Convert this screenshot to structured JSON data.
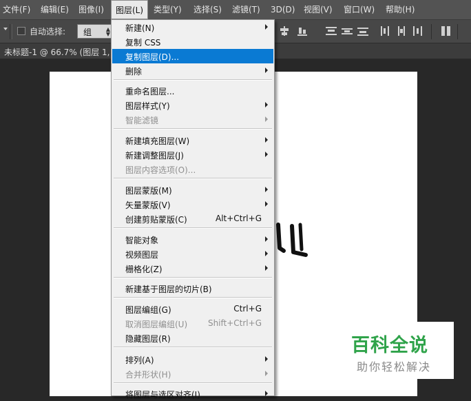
{
  "menubar": {
    "items": [
      {
        "label": "文件(F)"
      },
      {
        "label": "编辑(E)"
      },
      {
        "label": "图像(I)"
      },
      {
        "label": "图层(L)"
      },
      {
        "label": "类型(Y)"
      },
      {
        "label": "选择(S)"
      },
      {
        "label": "滤镜(T)"
      },
      {
        "label": "3D(D)"
      },
      {
        "label": "视图(V)"
      },
      {
        "label": "窗口(W)"
      },
      {
        "label": "帮助(H)"
      }
    ]
  },
  "options": {
    "auto_select_label": "自动选择:",
    "auto_select_value": "组"
  },
  "document": {
    "tab_title": "未标题-1 @ 66.7% (图层 1,"
  },
  "layer_menu": {
    "items": [
      {
        "label": "新建(N)"
      },
      {
        "label": "复制 CSS"
      },
      {
        "label": "复制图层(D)..."
      },
      {
        "label": "删除"
      },
      {
        "label": "重命名图层..."
      },
      {
        "label": "图层样式(Y)"
      },
      {
        "label": "智能滤镜"
      },
      {
        "label": "新建填充图层(W)"
      },
      {
        "label": "新建调整图层(J)"
      },
      {
        "label": "图层内容选项(O)..."
      },
      {
        "label": "图层蒙版(M)"
      },
      {
        "label": "矢量蒙版(V)"
      },
      {
        "label": "创建剪贴蒙版(C)",
        "shortcut": "Alt+Ctrl+G"
      },
      {
        "label": "智能对象"
      },
      {
        "label": "视频图层"
      },
      {
        "label": "栅格化(Z)"
      },
      {
        "label": "新建基于图层的切片(B)"
      },
      {
        "label": "图层编组(G)",
        "shortcut": "Ctrl+G"
      },
      {
        "label": "取消图层编组(U)",
        "shortcut": "Shift+Ctrl+G"
      },
      {
        "label": "隐藏图层(R)"
      },
      {
        "label": "排列(A)"
      },
      {
        "label": "合并形状(H)"
      },
      {
        "label": "将图层与选区对齐(I)"
      }
    ],
    "highlight_color": "#0a7ad3"
  },
  "watermark": {
    "title": "百科全说",
    "subtitle": "助你轻松解决",
    "color": "#2fa34a"
  }
}
